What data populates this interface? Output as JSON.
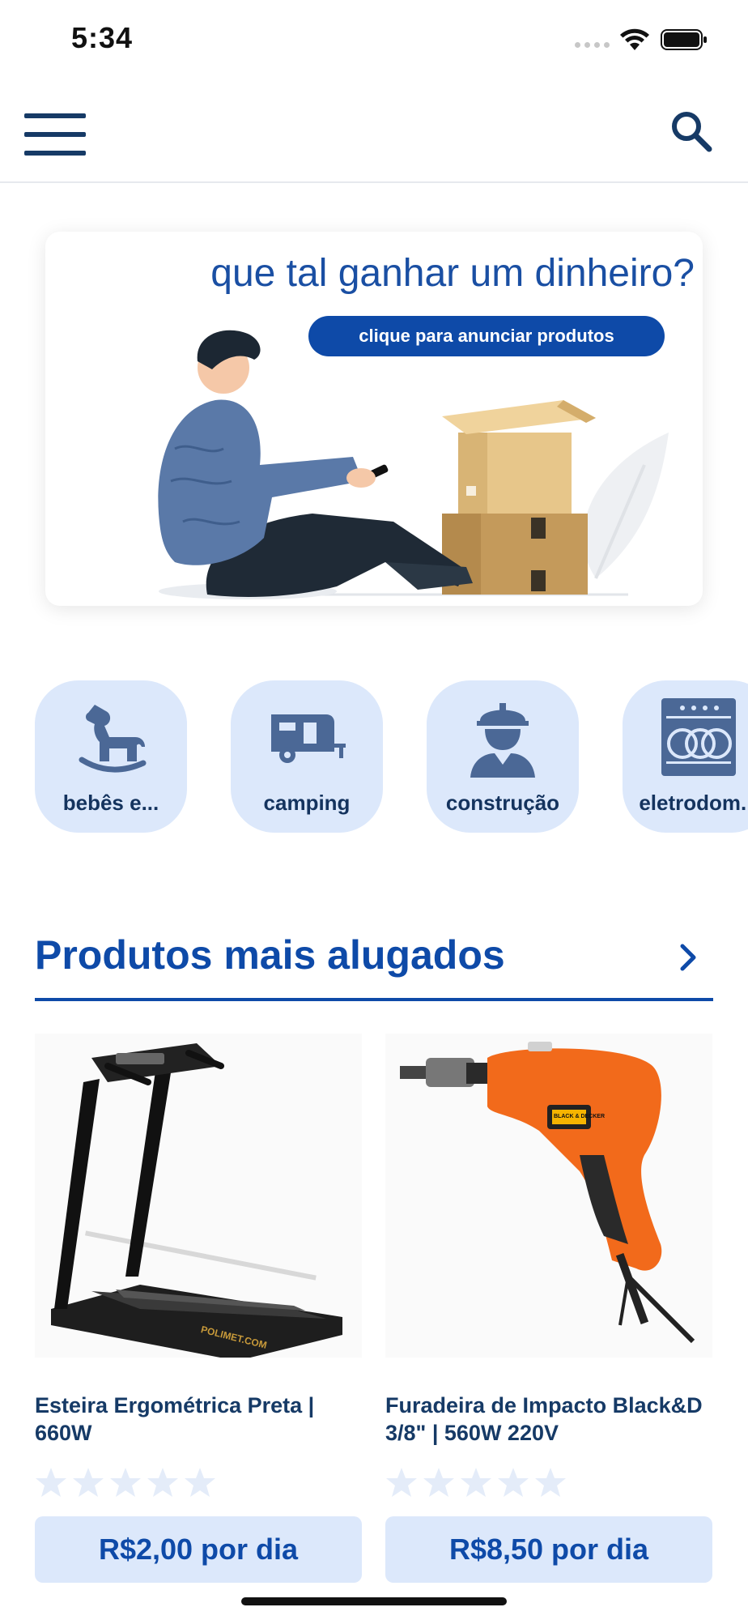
{
  "status_bar": {
    "time": "5:34"
  },
  "banner": {
    "title": "que tal ganhar um dinheiro?",
    "cta_label": "clique para anunciar produtos"
  },
  "categories": [
    {
      "label": "bebês e...",
      "icon": "rocking-horse-icon"
    },
    {
      "label": "camping",
      "icon": "camper-trailer-icon"
    },
    {
      "label": "construção",
      "icon": "construction-worker-icon"
    },
    {
      "label": "eletrodom...",
      "icon": "dishwasher-icon"
    }
  ],
  "section": {
    "title": "Produtos mais alugados"
  },
  "products": [
    {
      "name": "Esteira Ergométrica Preta | 660W",
      "price": "R$2,00 por dia",
      "rating": 0,
      "image": "treadmill",
      "image_brand": "POLIMET.COM"
    },
    {
      "name": "Furadeira de Impacto Black&D 3/8\" | 560W 220V",
      "price": "R$8,50 por dia",
      "rating": 0,
      "image": "impact-drill",
      "image_brand": "BLACK & DECKER"
    }
  ],
  "colors": {
    "primary": "#0e4aa8",
    "text_dark": "#163a66",
    "chip_bg": "#dce8fb",
    "star_empty": "#e4ecf9"
  }
}
